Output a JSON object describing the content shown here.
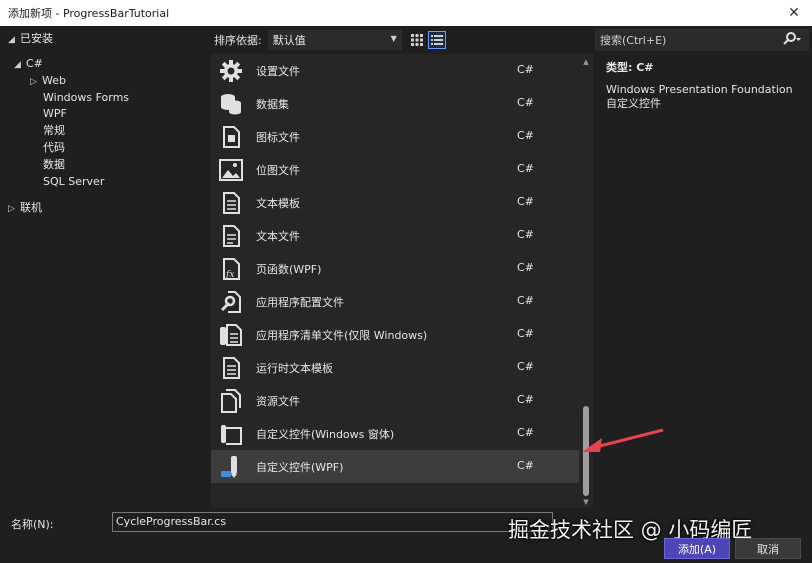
{
  "window": {
    "title": "添加新项 - ProgressBarTutorial",
    "close_glyph": "✕"
  },
  "tree": {
    "installed": "已安装",
    "csharp": "C#",
    "children": [
      "Web",
      "Windows Forms",
      "WPF",
      "常规",
      "代码",
      "数据",
      "SQL Server"
    ],
    "online": "联机"
  },
  "sort": {
    "label": "排序依据:",
    "value": "默认值"
  },
  "items": [
    {
      "name": "设置文件",
      "lang": "C#",
      "icon": "gear-icon"
    },
    {
      "name": "数据集",
      "lang": "C#",
      "icon": "database-icon"
    },
    {
      "name": "图标文件",
      "lang": "C#",
      "icon": "icon-file-icon"
    },
    {
      "name": "位图文件",
      "lang": "C#",
      "icon": "image-icon"
    },
    {
      "name": "文本模板",
      "lang": "C#",
      "icon": "text-template-icon"
    },
    {
      "name": "文本文件",
      "lang": "C#",
      "icon": "text-file-icon"
    },
    {
      "name": "页函数(WPF)",
      "lang": "C#",
      "icon": "page-function-icon"
    },
    {
      "name": "应用程序配置文件",
      "lang": "C#",
      "icon": "config-file-icon"
    },
    {
      "name": "应用程序清单文件(仅限 Windows)",
      "lang": "C#",
      "icon": "manifest-icon"
    },
    {
      "name": "运行时文本模板",
      "lang": "C#",
      "icon": "runtime-template-icon"
    },
    {
      "name": "资源文件",
      "lang": "C#",
      "icon": "resource-file-icon"
    },
    {
      "name": "自定义控件(Windows 窗体)",
      "lang": "C#",
      "icon": "custom-control-winforms-icon"
    },
    {
      "name": "自定义控件(WPF)",
      "lang": "C#",
      "icon": "custom-control-wpf-icon",
      "selected": true
    }
  ],
  "search": {
    "placeholder": "搜索(Ctrl+E)"
  },
  "detail": {
    "type": "类型: C#",
    "description": "Windows Presentation Foundation 自定义控件"
  },
  "bottom": {
    "name_label": "名称(N):",
    "name_value": "CycleProgressBar.cs",
    "add_label": "添加(A)",
    "cancel_label": "取消"
  },
  "watermark": "掘金技术社区 @ 小码编匠",
  "colors": {
    "accent": "#4c46b8",
    "arrow": "#e8434f",
    "selected_row": "#3d3d3d"
  }
}
